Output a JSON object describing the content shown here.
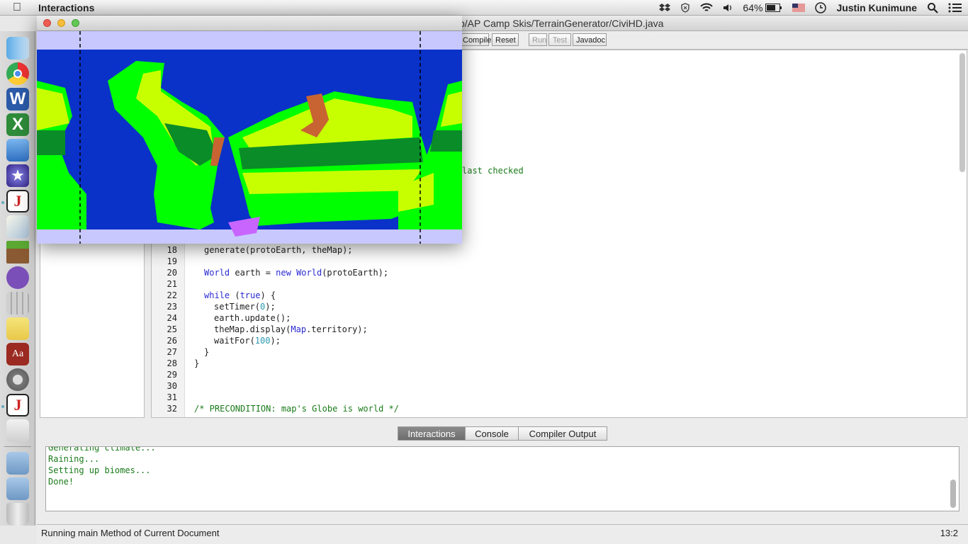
{
  "menubar": {
    "app_name": "Interactions",
    "battery": "64%",
    "user": "Justin Kunimune"
  },
  "ide": {
    "title": "p/AP Camp Skis/TerrainGenerator/CiviHD.java",
    "toolbar": {
      "compile": "Compile",
      "reset": "Reset",
      "run": "Run",
      "test": "Test",
      "javadoc": "Javadoc"
    },
    "code_fragment_top": "last checked",
    "lines": [
      {
        "n": "18",
        "text": "generate(protoEarth, theMap);"
      },
      {
        "n": "19",
        "text": ""
      },
      {
        "n": "20",
        "text": "World earth = new World(protoEarth);"
      },
      {
        "n": "21",
        "text": ""
      },
      {
        "n": "22",
        "text": "while (true) {"
      },
      {
        "n": "23",
        "text": "setTimer(0);"
      },
      {
        "n": "24",
        "text": "earth.update();"
      },
      {
        "n": "25",
        "text": "theMap.display(Map.territory);"
      },
      {
        "n": "26",
        "text": "waitFor(100);"
      },
      {
        "n": "27",
        "text": "}"
      },
      {
        "n": "28",
        "text": "}"
      },
      {
        "n": "29",
        "text": ""
      },
      {
        "n": "30",
        "text": ""
      },
      {
        "n": "31",
        "text": ""
      },
      {
        "n": "32",
        "text": "/* PRECONDITION: map's Globe is world */"
      }
    ],
    "tabs": [
      "Interactions",
      "Console",
      "Compiler Output"
    ],
    "console_lines": [
      "Generating climate...",
      "Raining...",
      "Setting up biomes...",
      "Done!"
    ],
    "status_message": "Running main Method of Current Document",
    "cursor_position": "13:2"
  },
  "colors": {
    "ocean": "#0a32c8",
    "grass_light": "#00ff00",
    "grass_mid": "#c8ff00",
    "forest": "#0a8c28",
    "mountain": "#c86432",
    "tundra": "#c8c8ff",
    "code_keyword": "#2a2ad0",
    "code_comment": "#1a7a1a"
  }
}
